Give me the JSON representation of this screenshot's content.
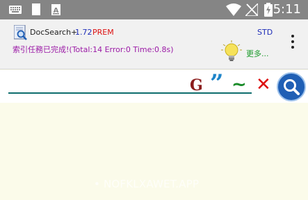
{
  "status_bar": {
    "time": "5:11",
    "icons": [
      "keyboard-icon",
      "notification-icon",
      "font-icon",
      "wifi-icon",
      "signal-icon",
      "battery-icon"
    ]
  },
  "header": {
    "app_name": "DocSearch+",
    "version": "1.72",
    "edition": "PREM",
    "std_label": "STD",
    "index_status": "索引任務已完成!(Total:14 Error:0 Time:0.8s)",
    "more_label": "更多..."
  },
  "search": {
    "query": "",
    "placeholder": "",
    "g_label": "G",
    "quote_label": "”",
    "tilde_label": "~",
    "clear_label": "✕"
  },
  "content": {
    "watermark": "• NOFKLXAWET.APP"
  },
  "colors": {
    "status_bar": "#858585",
    "header_bg": "#f1f1f1",
    "content_bg": "#fbfbea",
    "accent_teal": "#0e6d6d",
    "status_text": "#9b1aa6"
  }
}
